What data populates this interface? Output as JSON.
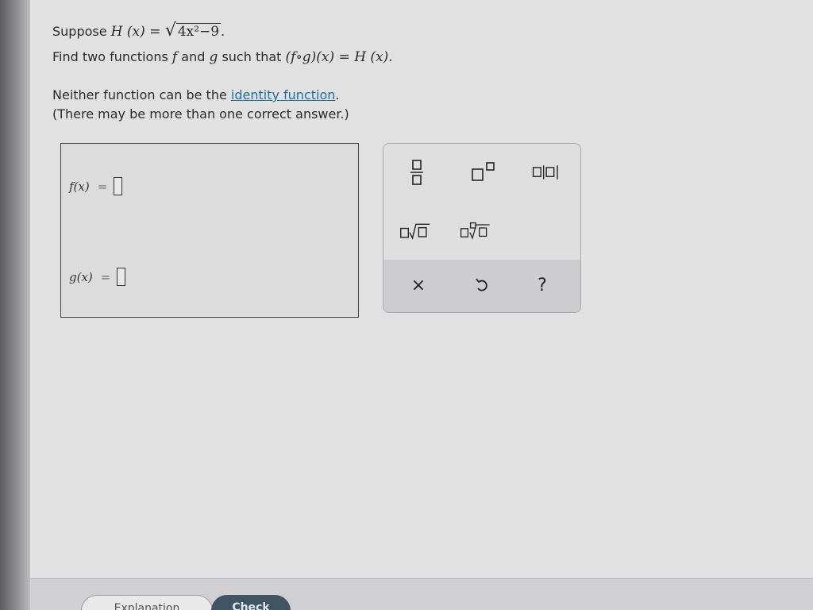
{
  "question": {
    "line1_prefix": "Suppose ",
    "line1_fn": "H (x) = ",
    "line1_radicand": "4x²−9",
    "line1_suffix": ".",
    "line2_prefix": "Find two functions ",
    "line2_f": "f",
    "line2_and": " and ",
    "line2_g": "g",
    "line2_mid": " such that ",
    "line2_comp": "(f∘g)(x) = H (x).",
    "line3_prefix": "Neither function can be the ",
    "line3_link": "identity function",
    "line3_suffix": ".",
    "line4": "(There may be more than one correct answer.)"
  },
  "answers": {
    "f_label": "f(x)",
    "g_label": "g(x)",
    "equals": "="
  },
  "palette": {
    "buttons": [
      "fraction-icon",
      "superscript-icon",
      "absolute-value-icon",
      "square-root-icon",
      "nth-root-icon"
    ],
    "actions": {
      "clear": "×",
      "undo_icon": "undo-icon",
      "help": "?"
    }
  },
  "footer": {
    "explanation_label": "Explanation",
    "check_label": "Check"
  }
}
